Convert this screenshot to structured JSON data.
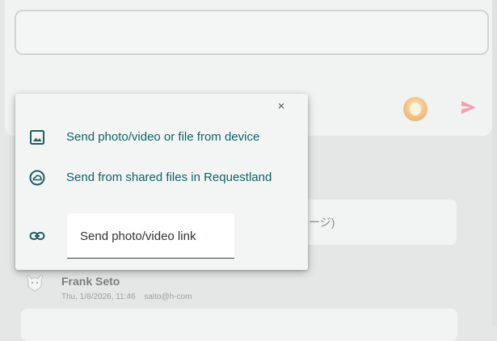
{
  "colors": {
    "accent": "#0e6268",
    "icon": "#1f5e63",
    "send": "#f0607a",
    "menu_bg": "#f3f5f4"
  },
  "composer": {
    "avatar_icon": "user-avatar-icon",
    "send_icon": "send-icon"
  },
  "attach_menu": {
    "close_label": "×",
    "items": [
      {
        "icon": "image-icon",
        "label": "Send photo/video or file from device"
      },
      {
        "icon": "cloud-icon",
        "label": "Send from shared files in Requestland"
      }
    ],
    "link": {
      "icon": "link-icon",
      "placeholder": "Send photo/video link"
    }
  },
  "background_thread": {
    "partial_message_text": "ージ)",
    "sender": {
      "name": "Frank Seto",
      "timestamp": "Thu, 1/8/2026, 11:46",
      "handle": "saito@h-com"
    }
  }
}
